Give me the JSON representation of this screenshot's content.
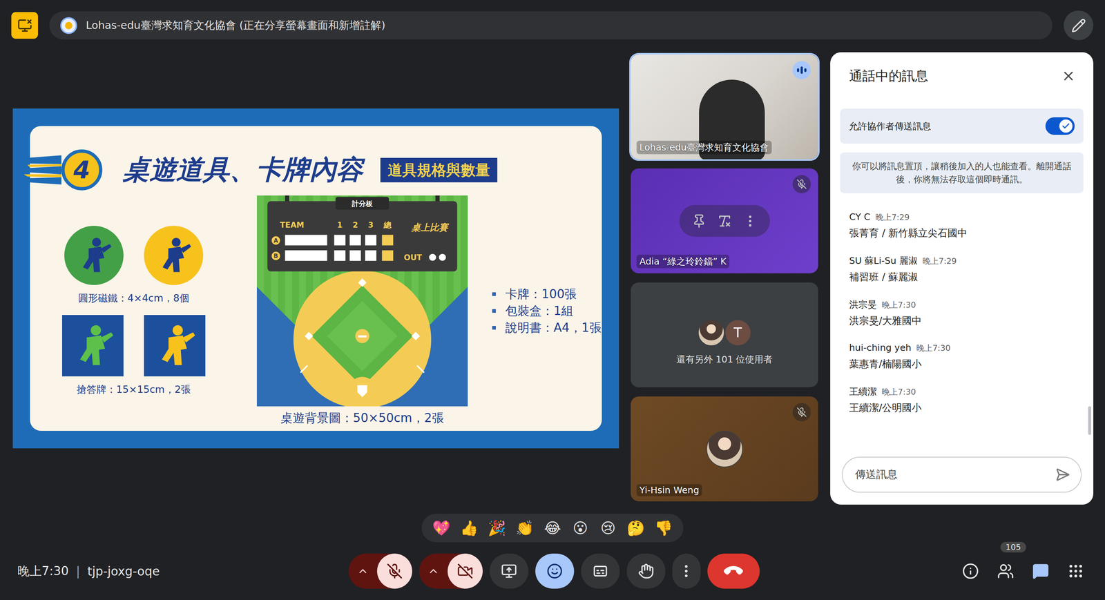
{
  "top_bar": {
    "title": "Lohas-edu臺灣求知育文化協會 (正在分享螢幕畫面和新增註解)"
  },
  "slide": {
    "number": "4",
    "title": "桌遊道具、卡牌內容",
    "tag": "道具規格與數量",
    "magnets": [
      {
        "color": "#43a047"
      },
      {
        "color": "#f7c21c"
      }
    ],
    "magnets_label": "圓形磁鐵：4×4cm，8個",
    "answer_cards": [
      {
        "color": "#5cc04a"
      },
      {
        "color": "#f7c21c"
      }
    ],
    "answer_cards_label": "搶答牌：15×15cm，2張",
    "scoreboard": {
      "title": "計分板",
      "team": "TEAM",
      "innings": [
        "1",
        "2",
        "3",
        "總"
      ],
      "rows": [
        "A",
        "B"
      ],
      "out": "OUT",
      "logo": "桌上比賽"
    },
    "board_caption": "桌遊背景圖：50×50cm，2張",
    "list": [
      "卡牌：100張",
      "包裝盒：1組",
      "說明書：A4，1張"
    ]
  },
  "tiles": [
    {
      "kind": "video",
      "name": "Lohas-edu臺灣求知育文化協會",
      "speaking": true,
      "muted": false,
      "hovered": false
    },
    {
      "kind": "color",
      "name": "Adia “綠之玲鈴鐺” K",
      "speaking": false,
      "muted": true,
      "hovered": true
    },
    {
      "kind": "others",
      "label": "還有另外 101 位使用者",
      "avatars": [
        {
          "kind": "photo",
          "text": ""
        },
        {
          "kind": "initial",
          "text": "T"
        }
      ]
    },
    {
      "kind": "avatar",
      "name": "Yi-Hsin Weng",
      "speaking": false,
      "muted": true,
      "hovered": false
    }
  ],
  "chat": {
    "title": "通話中的訊息",
    "toggle": {
      "label": "允許協作者傳送訊息",
      "on": true
    },
    "info": "你可以將訊息置頂，讓稍後加入的人也能查看。離開通話後，你將無法存取這個即時通訊。",
    "messages": [
      {
        "sender": "CY C",
        "time": "晚上7:29",
        "text": "張菁育 / 新竹縣立尖石國中"
      },
      {
        "sender": "SU 蘇Li-Su 麗淑",
        "time": "晚上7:29",
        "text": "補習班 / 蘇麗淑"
      },
      {
        "sender": "洪宗旻",
        "time": "晚上7:30",
        "text": "洪宗旻/大雅國中"
      },
      {
        "sender": "hui-ching yeh",
        "time": "晚上7:30",
        "text": "葉惠青/楠陽國小"
      },
      {
        "sender": "王續潔",
        "time": "晚上7:30",
        "text": "王續潔/公明國小"
      }
    ],
    "input": {
      "placeholder": "傳送訊息"
    }
  },
  "reactions": [
    "💖",
    "👍",
    "🎉",
    "👏",
    "😂",
    "😮",
    "😢",
    "🤔",
    "👎"
  ],
  "bottom_bar": {
    "time": "晚上7:30",
    "separator": "|",
    "meeting_code": "tjp-joxg-oqe",
    "controls": [
      {
        "kind": "microphone",
        "on": false,
        "selected": false
      },
      {
        "kind": "camera",
        "on": false,
        "selected": false
      },
      {
        "kind": "present",
        "on": false,
        "selected": false
      },
      {
        "kind": "reactions",
        "on": false,
        "selected": true
      },
      {
        "kind": "captions",
        "on": false,
        "selected": false
      },
      {
        "kind": "raise-hand",
        "on": false,
        "selected": false
      },
      {
        "kind": "more",
        "on": false,
        "selected": false
      },
      {
        "kind": "leave",
        "on": false,
        "selected": false
      }
    ],
    "side_buttons": [
      {
        "kind": "info",
        "selected": false,
        "badge": ""
      },
      {
        "kind": "people",
        "selected": false,
        "badge": "105"
      },
      {
        "kind": "chat",
        "selected": true,
        "badge": ""
      },
      {
        "kind": "activities",
        "selected": false,
        "badge": ""
      }
    ]
  }
}
